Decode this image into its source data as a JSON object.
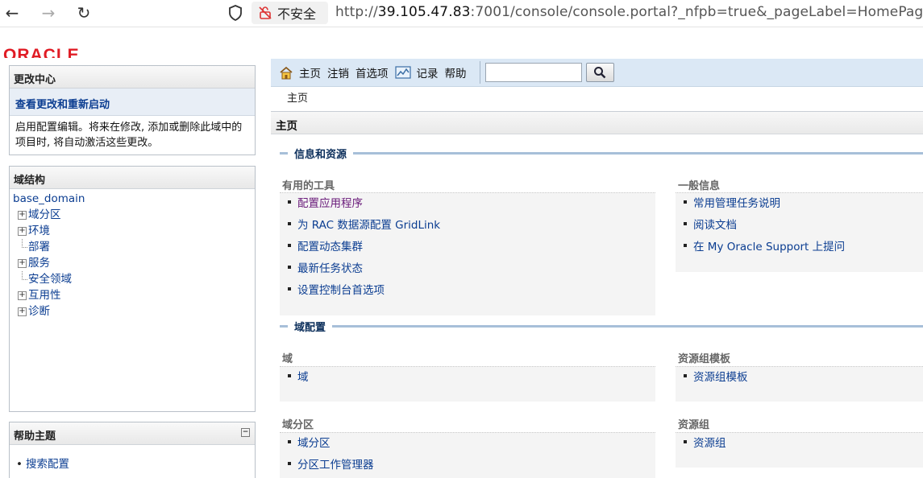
{
  "browser": {
    "insecure_label": "不安全",
    "url_prefix": "http://",
    "url_host": "39.105.47.83",
    "url_rest": ":7001/console/console.portal?_nfpb=true&_pageLabel=HomePage1"
  },
  "logo": {
    "text": "ORACLE"
  },
  "change_center": {
    "title": "更改中心",
    "link": "查看更改和重新启动",
    "text": "启用配置编辑。将来在修改, 添加或删除此域中的项目时, 将自动激活这些更改。"
  },
  "domain_structure": {
    "title": "域结构",
    "root": "base_domain",
    "items": [
      {
        "label": "域分区",
        "expandable": true
      },
      {
        "label": "环境",
        "expandable": true
      },
      {
        "label": "部署",
        "expandable": false
      },
      {
        "label": "服务",
        "expandable": true
      },
      {
        "label": "安全领域",
        "expandable": false
      },
      {
        "label": "互用性",
        "expandable": true
      },
      {
        "label": "诊断",
        "expandable": true
      }
    ]
  },
  "help_topics": {
    "title": "帮助主题",
    "items": [
      "搜索配置"
    ]
  },
  "toolbar": {
    "home": "主页",
    "logout": "注销",
    "preferences": "首选项",
    "record": "记录",
    "help": "帮助",
    "search_value": ""
  },
  "breadcrumb": "主页",
  "page_title": "主页",
  "sections": {
    "info": "信息和资源",
    "domain_config": "域配置"
  },
  "useful_tools": {
    "title": "有用的工具",
    "items": [
      "配置应用程序",
      "为 RAC 数据源配置 GridLink",
      "配置动态集群",
      "最新任务状态",
      "设置控制台首选项"
    ]
  },
  "general_info": {
    "title": "一般信息",
    "items": [
      "常用管理任务说明",
      "阅读文档",
      "在 My Oracle Support 上提问"
    ]
  },
  "domain_box": {
    "title": "域",
    "items": [
      "域"
    ]
  },
  "rg_template_box": {
    "title": "资源组模板",
    "items": [
      "资源组模板"
    ]
  },
  "partition_box": {
    "title": "域分区",
    "items": [
      "域分区",
      "分区工作管理器"
    ]
  },
  "rg_box": {
    "title": "资源组",
    "items": [
      "资源组"
    ]
  }
}
